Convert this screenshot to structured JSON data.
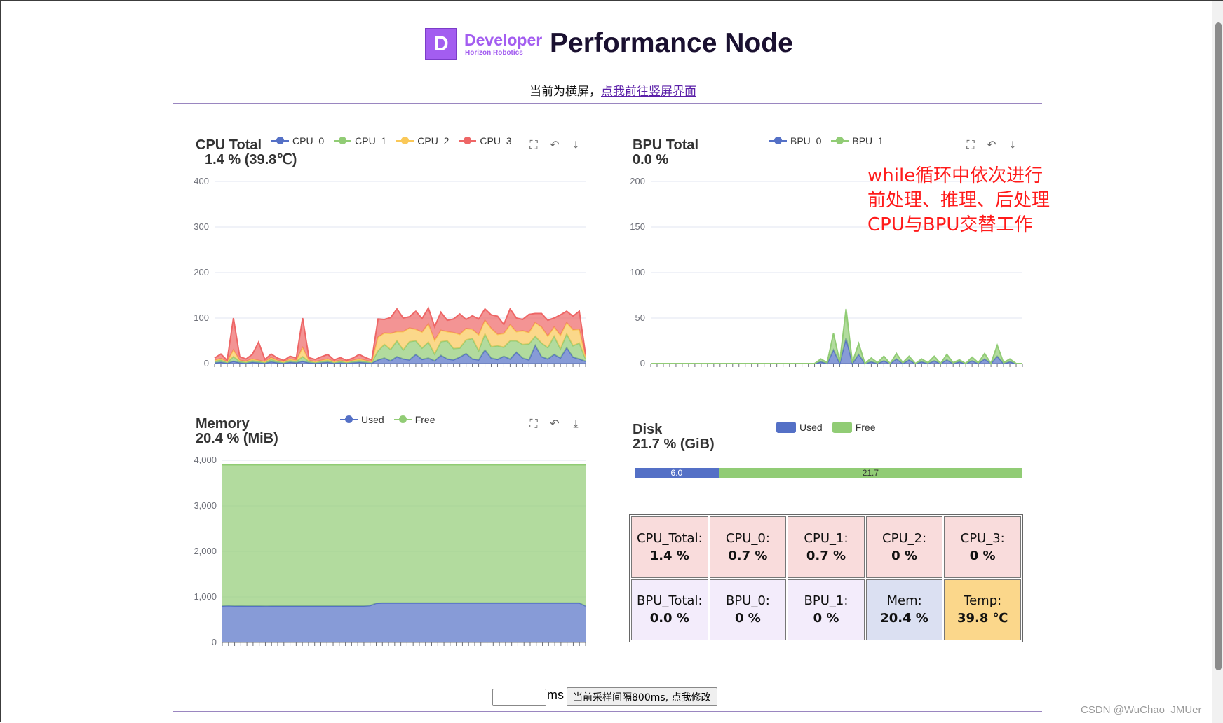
{
  "header": {
    "logo_text": "Developer",
    "logo_sub": "Horizon Robotics",
    "logo_letter": "D",
    "title": "Performance Node",
    "subtitle_prefix": "当前为横屏，",
    "subtitle_link": "点我前往竖屏界面"
  },
  "colors": {
    "blue": "#5470c6",
    "green": "#91cc75",
    "yellow": "#fac858",
    "red": "#ee6666",
    "accent": "#a35df0"
  },
  "toolbox_icons": [
    "zoom-icon",
    "restore-icon",
    "download-icon"
  ],
  "annotation": "while循环中依次进行\n前处理、推理、后处理\nCPU与BPU交替工作",
  "chart_data": [
    {
      "type": "area",
      "stacked": true,
      "title": "CPU Total",
      "subtitle": "1.4 % (39.8℃)",
      "ylim": [
        0,
        400
      ],
      "yticks": [
        "0",
        "100",
        "200",
        "300",
        "400"
      ],
      "grid": true,
      "legend": "top",
      "series": [
        {
          "name": "CPU_0",
          "color": "#5470c6",
          "values": [
            2,
            3,
            1,
            5,
            2,
            1,
            3,
            2,
            1,
            4,
            2,
            1,
            3,
            2,
            5,
            2,
            1,
            2,
            3,
            1,
            2,
            1,
            2,
            3,
            2,
            1,
            8,
            12,
            6,
            15,
            10,
            8,
            20,
            9,
            12,
            6,
            18,
            10,
            8,
            14,
            22,
            10,
            8,
            30,
            12,
            9,
            16,
            10,
            25,
            12,
            8,
            40,
            15,
            10,
            20,
            12,
            35,
            14,
            10,
            5
          ]
        },
        {
          "name": "CPU_1",
          "color": "#91cc75",
          "values": [
            3,
            5,
            2,
            10,
            3,
            2,
            4,
            3,
            2,
            5,
            3,
            2,
            4,
            3,
            10,
            3,
            2,
            3,
            4,
            2,
            3,
            2,
            3,
            4,
            3,
            2,
            20,
            30,
            25,
            35,
            20,
            40,
            30,
            25,
            35,
            15,
            30,
            40,
            25,
            20,
            30,
            45,
            20,
            35,
            25,
            30,
            20,
            40,
            25,
            30,
            35,
            20,
            30,
            25,
            40,
            20,
            30,
            25,
            35,
            5
          ]
        },
        {
          "name": "CPU_2",
          "color": "#fac858",
          "values": [
            2,
            3,
            1,
            15,
            2,
            2,
            3,
            2,
            1,
            4,
            2,
            1,
            3,
            2,
            20,
            2,
            1,
            2,
            3,
            1,
            2,
            1,
            2,
            3,
            2,
            1,
            30,
            25,
            35,
            20,
            40,
            30,
            25,
            35,
            40,
            30,
            25,
            20,
            35,
            30,
            25,
            20,
            35,
            30,
            40,
            25,
            30,
            35,
            20,
            30,
            25,
            30,
            35,
            25,
            20,
            30,
            25,
            35,
            30,
            5
          ]
        },
        {
          "name": "CPU_3",
          "color": "#ee6666",
          "values": [
            5,
            10,
            3,
            70,
            8,
            5,
            10,
            40,
            5,
            8,
            5,
            3,
            6,
            5,
            65,
            6,
            5,
            8,
            10,
            4,
            6,
            3,
            5,
            10,
            6,
            4,
            40,
            30,
            35,
            50,
            30,
            25,
            40,
            30,
            35,
            30,
            40,
            25,
            30,
            45,
            20,
            30,
            35,
            25,
            30,
            40,
            20,
            35,
            30,
            25,
            40,
            20,
            30,
            35,
            20,
            45,
            25,
            30,
            40,
            5
          ]
        }
      ]
    },
    {
      "type": "area",
      "stacked": true,
      "title": "BPU Total",
      "subtitle": "0.0 %",
      "ylim": [
        0,
        200
      ],
      "yticks": [
        "0",
        "50",
        "100",
        "150",
        "200"
      ],
      "grid": true,
      "legend": "top",
      "series": [
        {
          "name": "BPU_0",
          "color": "#5470c6",
          "values": [
            0,
            0,
            0,
            0,
            0,
            0,
            0,
            0,
            0,
            0,
            0,
            0,
            0,
            0,
            0,
            0,
            0,
            0,
            0,
            0,
            0,
            0,
            0,
            0,
            0,
            0,
            0,
            2,
            0,
            15,
            0,
            28,
            0,
            10,
            0,
            2,
            0,
            3,
            0,
            5,
            0,
            4,
            0,
            2,
            0,
            3,
            0,
            4,
            0,
            2,
            0,
            3,
            0,
            5,
            0,
            8,
            0,
            2,
            0,
            0
          ]
        },
        {
          "name": "BPU_1",
          "color": "#91cc75",
          "values": [
            0,
            0,
            0,
            0,
            0,
            0,
            0,
            0,
            0,
            0,
            0,
            0,
            0,
            0,
            0,
            0,
            0,
            0,
            0,
            0,
            0,
            0,
            0,
            0,
            0,
            0,
            0,
            3,
            1,
            18,
            2,
            32,
            1,
            12,
            0,
            4,
            1,
            5,
            0,
            6,
            1,
            4,
            0,
            3,
            1,
            5,
            0,
            6,
            1,
            2,
            0,
            4,
            1,
            6,
            0,
            12,
            1,
            3,
            0,
            0
          ]
        }
      ]
    },
    {
      "type": "area",
      "stacked": true,
      "title": "Memory",
      "subtitle": "20.4 % (MiB)",
      "ylim": [
        0,
        4000
      ],
      "yticks": [
        "0",
        "1,000",
        "2,000",
        "3,000",
        "4,000"
      ],
      "grid": true,
      "legend": "top",
      "series": [
        {
          "name": "Used",
          "color": "#5470c6",
          "values": [
            800,
            805,
            800,
            802,
            800,
            800,
            800,
            798,
            800,
            800,
            800,
            800,
            800,
            800,
            800,
            800,
            800,
            800,
            800,
            800,
            800,
            800,
            800,
            800,
            810,
            860,
            865,
            865,
            865,
            865,
            865,
            865,
            865,
            865,
            865,
            865,
            865,
            865,
            865,
            865,
            865,
            865,
            865,
            865,
            865,
            865,
            865,
            865,
            865,
            865,
            865,
            865,
            865,
            865,
            865,
            865,
            865,
            865,
            865,
            800
          ]
        },
        {
          "name": "Free",
          "color": "#91cc75",
          "values": [
            3100,
            3095,
            3100,
            3098,
            3100,
            3100,
            3100,
            3102,
            3100,
            3100,
            3100,
            3100,
            3100,
            3100,
            3100,
            3100,
            3100,
            3100,
            3100,
            3100,
            3100,
            3100,
            3100,
            3100,
            3090,
            3040,
            3035,
            3035,
            3035,
            3035,
            3035,
            3035,
            3035,
            3035,
            3035,
            3035,
            3035,
            3035,
            3035,
            3035,
            3035,
            3035,
            3035,
            3035,
            3035,
            3035,
            3035,
            3035,
            3035,
            3035,
            3035,
            3035,
            3035,
            3035,
            3035,
            3035,
            3035,
            3035,
            3035,
            3100
          ]
        }
      ]
    },
    {
      "type": "bar",
      "stacked": true,
      "horizontal": true,
      "title": "Disk",
      "subtitle": "21.7 % (GiB)",
      "legend": "top",
      "series": [
        {
          "name": "Used",
          "color": "#5470c6",
          "value": 6.0
        },
        {
          "name": "Free",
          "color": "#91cc75",
          "value": 21.7
        }
      ]
    }
  ],
  "stats": [
    {
      "label": "CPU_Total:",
      "value": "1.4 %",
      "color": "#f9dcdc"
    },
    {
      "label": "CPU_0:",
      "value": "0.7 %",
      "color": "#f9dcdc"
    },
    {
      "label": "CPU_1:",
      "value": "0.7 %",
      "color": "#f9dcdc"
    },
    {
      "label": "CPU_2:",
      "value": "0 %",
      "color": "#f9dcdc"
    },
    {
      "label": "CPU_3:",
      "value": "0 %",
      "color": "#f9dcdc"
    },
    {
      "label": "BPU_Total:",
      "value": "0.0 %",
      "color": "#f3ecfb"
    },
    {
      "label": "BPU_0:",
      "value": "0 %",
      "color": "#f3ecfb"
    },
    {
      "label": "BPU_1:",
      "value": "0 %",
      "color": "#f3ecfb"
    },
    {
      "label": "Mem:",
      "value": "20.4 %",
      "color": "#dbe0f2"
    },
    {
      "label": "Temp:",
      "value": "39.8 ℃",
      "color": "#fbd78b"
    }
  ],
  "footer": {
    "input_value": "",
    "unit": "ms",
    "button": "当前采样间隔800ms, 点我修改"
  },
  "watermark": "CSDN @WuChao_JMUer"
}
